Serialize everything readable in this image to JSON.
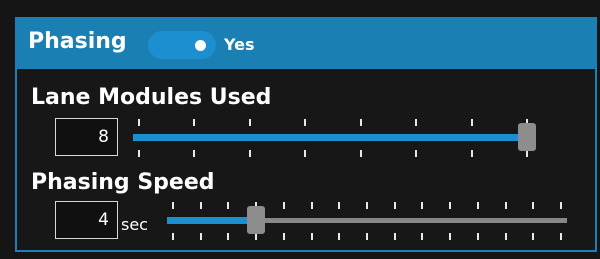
{
  "header": {
    "title": "Phasing",
    "toggle_on": true,
    "toggle_state": "Yes"
  },
  "lane_modules": {
    "label": "Lane Modules Used",
    "value": "8",
    "min": 1,
    "max": 8,
    "current": 8
  },
  "phasing_speed": {
    "label": "Phasing Speed",
    "value": "4",
    "unit": "sec",
    "min": 1,
    "max": 15,
    "current": 4
  },
  "colors": {
    "accent": "#1c8fd0",
    "header": "#1a7fb3",
    "thumb": "#8d8d8d",
    "track_inactive": "#888888"
  }
}
